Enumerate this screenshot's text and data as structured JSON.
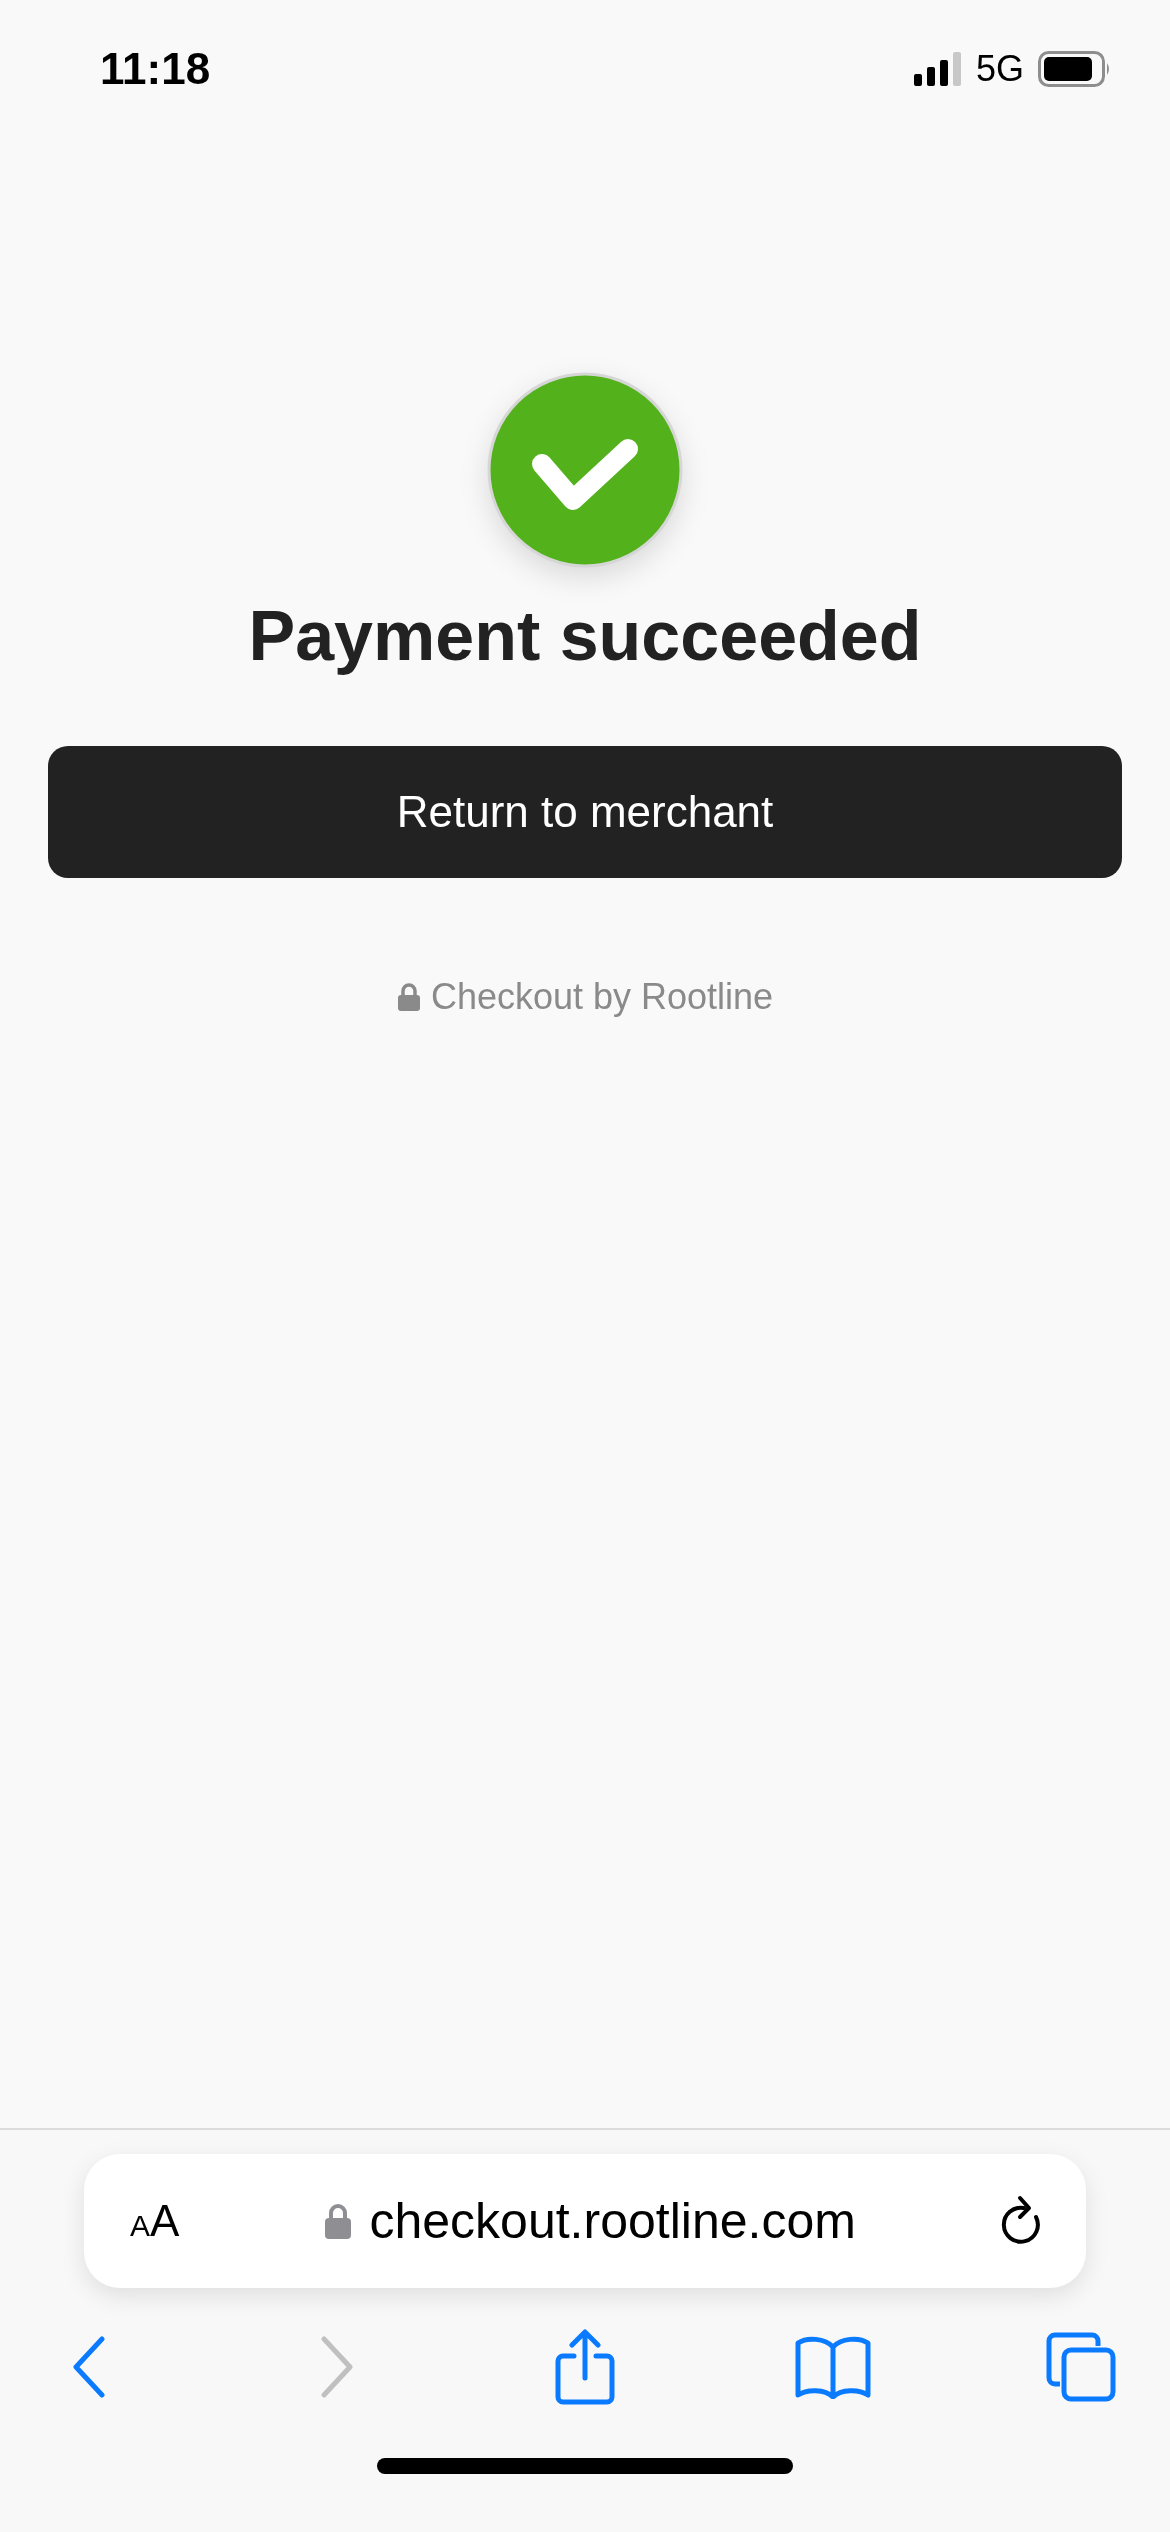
{
  "status_bar": {
    "time": "11:18",
    "network": "5G"
  },
  "result": {
    "succeeded": true,
    "title": "Payment succeeded"
  },
  "return_button": {
    "label": "Return to merchant"
  },
  "footer": {
    "text": "Checkout by Rootline"
  },
  "address_bar": {
    "text_size_button": {
      "small": "A",
      "large": "A"
    },
    "url": "checkout.rootline.com",
    "secure": true
  },
  "toolbar": [
    {
      "kind": "back",
      "disabled": false
    },
    {
      "kind": "forward",
      "disabled": true
    },
    {
      "kind": "share",
      "disabled": false
    },
    {
      "kind": "bookmarks",
      "disabled": false
    },
    {
      "kind": "tabs",
      "disabled": false
    }
  ]
}
